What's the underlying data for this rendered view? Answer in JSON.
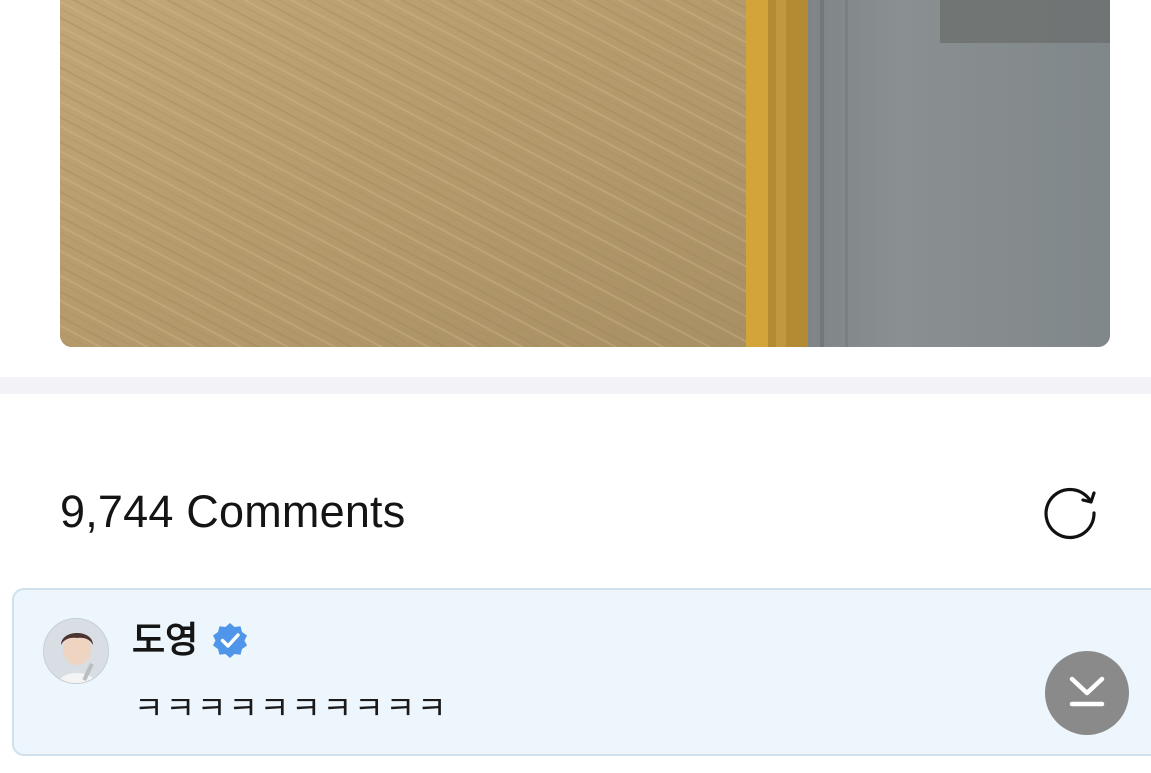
{
  "post": {
    "image_icon": "photo-image"
  },
  "comments": {
    "count_label": "9,744 Comments",
    "refresh_icon": "refresh-icon"
  },
  "pinned_comment": {
    "author": "도영",
    "verified": true,
    "text": "ㅋㅋㅋㅋㅋㅋㅋㅋㅋㅋ",
    "avatar_icon": "avatar",
    "scroll_down_icon": "scroll-to-bottom-icon"
  },
  "colors": {
    "verified_badge": "#4f95ea",
    "card_background": "#edf6fd",
    "card_border": "#cfe0ec",
    "fab_background": "#8a8a8a",
    "divider": "#f3f3f7"
  }
}
